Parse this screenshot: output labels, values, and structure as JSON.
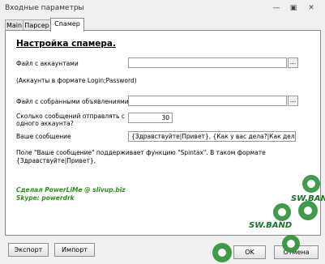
{
  "window": {
    "title": "Входные параметры"
  },
  "tabs": [
    {
      "label": "Main"
    },
    {
      "label": "Парсер"
    },
    {
      "label": "Спамер"
    }
  ],
  "settings": {
    "heading": "Настройка спамера.",
    "accounts_file_label": "Файл с аккаунтами",
    "accounts_file_value": "",
    "accounts_hint": "(Аккаунты в формате Login;Password)",
    "ads_file_label": "Файл с собранными объявлениями",
    "ads_file_value": "",
    "messages_count_label_line1": "Сколько сообщений отправлять с",
    "messages_count_label_line2": "одного аккаунта?",
    "messages_count_value": "30",
    "message_label": "Ваше сообщение",
    "message_value": "{Здравствуйте|Привет}, {Как у вас дела?|Как дела?}",
    "note_line1": "Поле \"Ваше сообщение\" поддерживает функцию \"Spintax\". В таком формате",
    "note_line2": "{Здравствуйте|Привет},",
    "browse_label": "...",
    "credit_line1": "Сделал PowerLiMe @ slivup.biz",
    "credit_line2": "Skype: powerdrk"
  },
  "buttons": {
    "export": "Экспорт",
    "import": "Импорт",
    "ok": "OK",
    "cancel": "Отмена"
  },
  "watermark": {
    "text": "SW.BAND"
  },
  "colors": {
    "credit": "#2e8b1e",
    "watermark": "#2f8f3a"
  }
}
